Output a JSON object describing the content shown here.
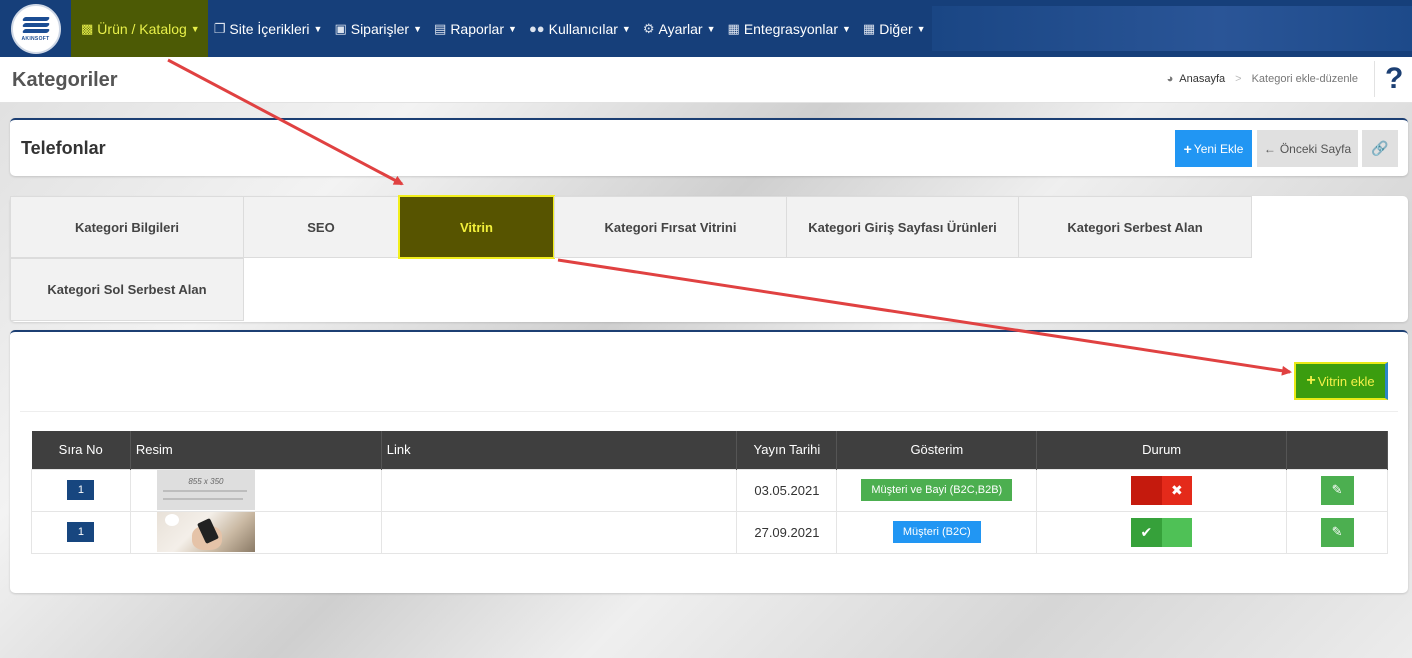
{
  "nav": {
    "logo_text": "AKINSOFT",
    "items": [
      {
        "label": "Ürün / Katalog",
        "icon": "cubes-icon"
      },
      {
        "label": "Site İçerikleri",
        "icon": "copy-icon"
      },
      {
        "label": "Siparişler",
        "icon": "truck-icon"
      },
      {
        "label": "Raporlar",
        "icon": "file-icon"
      },
      {
        "label": "Kullanıcılar",
        "icon": "users-icon"
      },
      {
        "label": "Ayarlar",
        "icon": "gears-icon"
      },
      {
        "label": "Entegrasyonlar",
        "icon": "sitemap-icon"
      },
      {
        "label": "Diğer",
        "icon": "grid-icon"
      }
    ]
  },
  "header": {
    "title": "Kategoriler",
    "breadcrumb_home": "Anasayfa",
    "breadcrumb_current": "Kategori ekle-düzenle",
    "help": "?"
  },
  "title_panel": {
    "title": "Telefonlar",
    "new_label": "Yeni Ekle",
    "prev_label": "Önceki Sayfa"
  },
  "tabs": [
    "Kategori Bilgileri",
    "SEO",
    "Vitrin",
    "Kategori Fırsat Vitrini",
    "Kategori Giriş Sayfası Ürünleri",
    "Kategori Serbest Alan",
    "Kategori Sol Serbest Alan"
  ],
  "active_tab": "Vitrin",
  "main": {
    "add_label": "Vitrin ekle",
    "columns": [
      "Sıra No",
      "Resim",
      "Link",
      "Yayın Tarihi",
      "Gösterim",
      "Durum",
      ""
    ],
    "rows": [
      {
        "order": "1",
        "image_text": "855 x 350",
        "link": "",
        "date": "03.05.2021",
        "display": "Müşteri ve Bayi (B2C,B2B)",
        "status": "inactive"
      },
      {
        "order": "1",
        "image_text": "",
        "link": "",
        "date": "27.09.2021",
        "display": "Müşteri (B2C)",
        "status": "active"
      }
    ]
  },
  "colors": {
    "nav_bg": "#163f7a",
    "active_tab_bg": "#575400",
    "highlight_text": "#f2f03a",
    "add_button": "#3b9d0f",
    "primary": "#2196f3",
    "success": "#4caf50",
    "danger": "#e42a1a",
    "annotation_arrow": "#e04141"
  }
}
